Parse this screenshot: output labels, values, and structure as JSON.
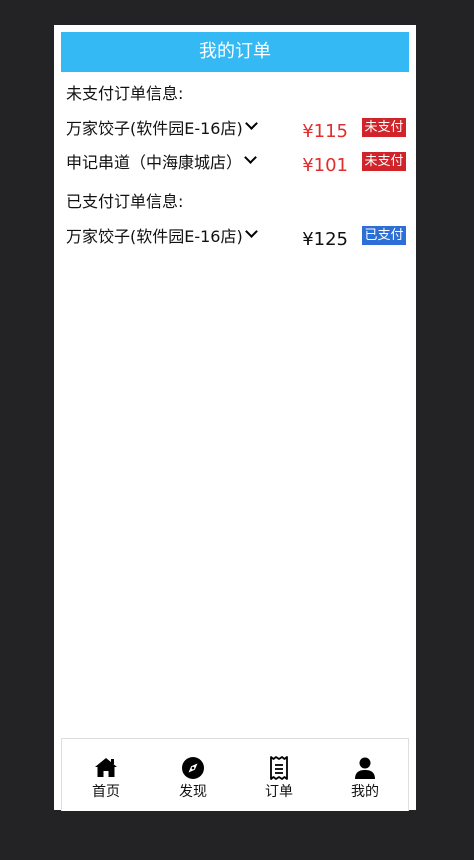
{
  "header": {
    "title": "我的订单"
  },
  "unpaid_section": {
    "title": "未支付订单信息:",
    "orders": [
      {
        "shop": "万家饺子(软件园E-16店)",
        "price": "¥115",
        "status": "未支付"
      },
      {
        "shop": "申记串道（中海康城店）",
        "price": "¥101",
        "status": "未支付"
      }
    ]
  },
  "paid_section": {
    "title": "已支付订单信息:",
    "orders": [
      {
        "shop": "万家饺子(软件园E-16店)",
        "price": "¥125",
        "status": "已支付"
      }
    ]
  },
  "tabbar": {
    "items": [
      {
        "label": "首页",
        "icon": "home-icon"
      },
      {
        "label": "发现",
        "icon": "compass-icon"
      },
      {
        "label": "订单",
        "icon": "receipt-icon"
      },
      {
        "label": "我的",
        "icon": "user-icon"
      }
    ]
  },
  "colors": {
    "header_bg": "#35b9f4",
    "unpaid_price": "#e02d2d",
    "unpaid_badge": "#d0242a",
    "paid_badge": "#2d6fd6"
  }
}
